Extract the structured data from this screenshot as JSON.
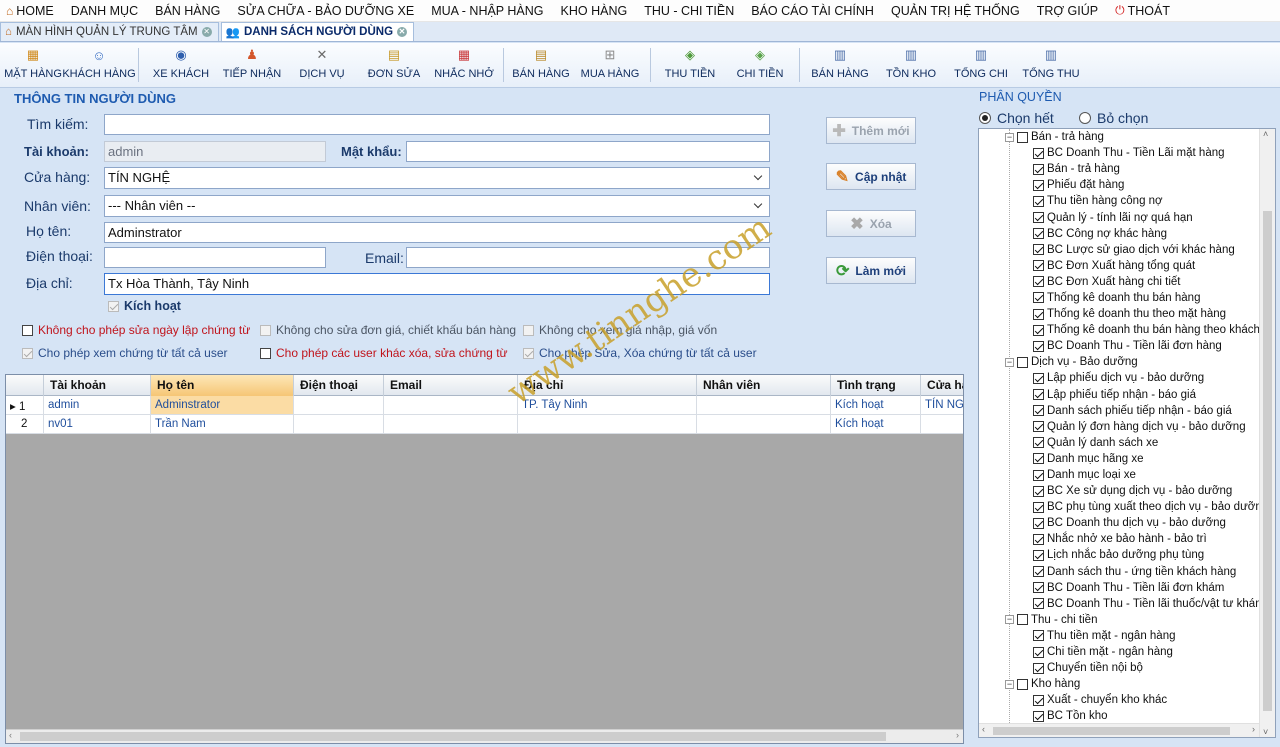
{
  "menu": {
    "items": [
      {
        "label": "HOME",
        "icon": "home-icon"
      },
      {
        "label": "DANH MỤC"
      },
      {
        "label": "BÁN HÀNG"
      },
      {
        "label": "SỬA CHỮA - BẢO DƯỠNG XE"
      },
      {
        "label": "MUA - NHẬP HÀNG"
      },
      {
        "label": "KHO HÀNG"
      },
      {
        "label": "THU - CHI TIỀN"
      },
      {
        "label": "BÁO CÁO TÀI CHÍNH"
      },
      {
        "label": "QUẢN TRỊ HỆ THỐNG"
      },
      {
        "label": "TRỢ GIÚP"
      },
      {
        "label": "THOÁT",
        "icon": "power-icon"
      }
    ]
  },
  "tabs": [
    {
      "label": "MÀN HÌNH QUẢN LÝ TRUNG TÂM",
      "active": false
    },
    {
      "label": "DANH SÁCH NGƯỜI DÙNG",
      "active": true
    }
  ],
  "toolbar": {
    "buttons": [
      {
        "label": "MẶT HÀNG",
        "icon": "box-icon",
        "color": "#d08a1c"
      },
      {
        "label": "KHÁCH HÀNG",
        "icon": "customer-icon",
        "color": "#3a6fc4"
      },
      {
        "label": "XE KHÁCH",
        "icon": "car-icon",
        "color": "#2f5fae"
      },
      {
        "label": "TIẾP NHẬN",
        "icon": "reception-icon",
        "color": "#d4572c"
      },
      {
        "label": "DỊCH VỤ",
        "icon": "tools-icon",
        "color": "#6b6b6b"
      },
      {
        "label": "ĐƠN SỬA",
        "icon": "repair-order-icon",
        "color": "#c79a2c"
      },
      {
        "label": "NHẮC NHỞ",
        "icon": "calendar-icon",
        "color": "#c9373a"
      },
      {
        "label": "BÁN HÀNG",
        "icon": "sale-icon",
        "color": "#b9892a"
      },
      {
        "label": "MUA HÀNG",
        "icon": "cart-icon",
        "color": "#8a8a8a"
      },
      {
        "label": "THU TIỀN",
        "icon": "money-in-icon",
        "color": "#4f9a3b"
      },
      {
        "label": "CHI TIỀN",
        "icon": "money-out-icon",
        "color": "#5aa34a"
      },
      {
        "label": "BÁN HÀNG",
        "icon": "report-sale-icon",
        "color": "#4c6ea8"
      },
      {
        "label": "TỒN KHO",
        "icon": "report-stock-icon",
        "color": "#4c6ea8"
      },
      {
        "label": "TỔNG CHI",
        "icon": "report-expense-icon",
        "color": "#4c6ea8"
      },
      {
        "label": "TỔNG THU",
        "icon": "report-income-icon",
        "color": "#4c6ea8"
      }
    ]
  },
  "form": {
    "section_title": "THÔNG TIN NGƯỜI DÙNG",
    "search_label": "Tìm kiếm:",
    "search_value": "",
    "account_label": "Tài khoản:",
    "account_value": "admin",
    "password_label": "Mật khẩu:",
    "password_value": "",
    "store_label": "Cửa hàng:",
    "store_value": "TÍN NGHỆ",
    "employee_label": "Nhân viên:",
    "employee_value": "--- Nhân viên --",
    "fullname_label": "Họ tên:",
    "fullname_value": "Adminstrator",
    "phone_label": "Điện thoại:",
    "phone_value": "",
    "email_label": "Email:",
    "email_value": "",
    "address_label": "Địa chỉ:",
    "address_value": "Tx Hòa Thành, Tây Ninh",
    "active_label": "Kích hoạt",
    "options": [
      {
        "label": "Không cho phép sửa ngày lập chứng từ",
        "checked": false,
        "enabled": true,
        "color": "#c0141c"
      },
      {
        "label": "Không cho sửa đơn giá, chiết khấu bán hàng",
        "checked": false,
        "enabled": false,
        "color": "#4b5563"
      },
      {
        "label": "Không cho xem giá nhập, giá vốn",
        "checked": false,
        "enabled": false,
        "color": "#4b5563"
      },
      {
        "label": "Cho phép xem chứng từ tất cả user",
        "checked": true,
        "enabled": false,
        "color": "#2a4d8a"
      },
      {
        "label": "Cho phép các user khác xóa, sửa chứng từ",
        "checked": false,
        "enabled": true,
        "color": "#c0141c"
      },
      {
        "label": "Cho phép Sửa, Xóa chứng từ tất cả user",
        "checked": true,
        "enabled": false,
        "color": "#2a4d8a"
      }
    ]
  },
  "actions": {
    "add_label": "Thêm mới",
    "update_label": "Cập nhật",
    "delete_label": "Xóa",
    "refresh_label": "Làm mới"
  },
  "grid": {
    "columns": [
      "Tài khoản",
      "Họ tên",
      "Điện thoại",
      "Email",
      "Địa chỉ",
      "Nhân viên",
      "Tình trạng",
      "Cửa hà"
    ],
    "rows": [
      {
        "no": "1",
        "account": "admin",
        "name": "Adminstrator",
        "phone": "",
        "email": "",
        "address": "TP. Tây Ninh",
        "employee": "",
        "status": "Kích hoạt",
        "store": "TÍN NGH"
      },
      {
        "no": "2",
        "account": "nv01",
        "name": "Trần Nam",
        "phone": "",
        "email": "",
        "address": "",
        "employee": "",
        "status": "Kích hoạt",
        "store": ""
      }
    ]
  },
  "permissions": {
    "title": "PHÂN QUYỀN",
    "select_all": "Chọn hết",
    "deselect_all": "Bỏ chọn",
    "groups": [
      {
        "label": "Bán - trả hàng",
        "items": [
          "BC Doanh Thu - Tiền Lãi mặt hàng",
          "Bán - trả hàng",
          "Phiếu đặt hàng",
          "Thu tiền hàng công nợ",
          "Quản lý - tính lãi nợ quá hạn",
          "BC Công nợ khác hàng",
          "BC Lược sử giao dịch với khác hàng",
          "BC Đơn Xuất hàng tổng quát",
          "BC Đơn Xuất hàng chi tiết",
          "Thống kê doanh thu bán hàng",
          "Thống kê doanh thu theo mặt hàng",
          "Thống kê doanh thu bán hàng theo khách hà",
          "BC Doanh Thu - Tiền lãi đơn hàng"
        ]
      },
      {
        "label": "Dịch vụ - Bảo dưỡng",
        "items": [
          "Lập phiếu dịch vụ - bảo dưỡng",
          "Lập phiếu tiếp nhận - báo giá",
          "Danh sách phiếu tiếp nhận - báo giá",
          "Quản lý đơn hàng dịch vụ - bảo dưỡng",
          "Quản lý danh sách xe",
          "Danh mục hãng xe",
          "Danh mục loại xe",
          "BC Xe sử dụng dịch vụ - bảo dưỡng",
          "BC phụ tùng xuất theo dịch vụ - bảo dưỡng",
          "BC Doanh thu dịch vụ - bảo dưỡng",
          "Nhắc nhở xe bảo hành - bảo trì",
          "Lịch nhắc bảo dưỡng phụ tùng",
          "Danh sách thu - ứng tiền khách hàng",
          "BC Doanh Thu - Tiền lãi đơn khám",
          "BC Doanh Thu - Tiền lãi thuốc/vật tư khám"
        ]
      },
      {
        "label": "Thu - chi tiền",
        "items": [
          "Thu tiền mặt - ngân hàng",
          "Chi tiền mặt - ngân hàng",
          "Chuyển tiền nội bộ"
        ]
      },
      {
        "label": "Kho hàng",
        "items": [
          "Xuất - chuyển kho khác",
          "BC Tồn kho"
        ]
      }
    ]
  },
  "watermark": "www.tinnghe.com"
}
